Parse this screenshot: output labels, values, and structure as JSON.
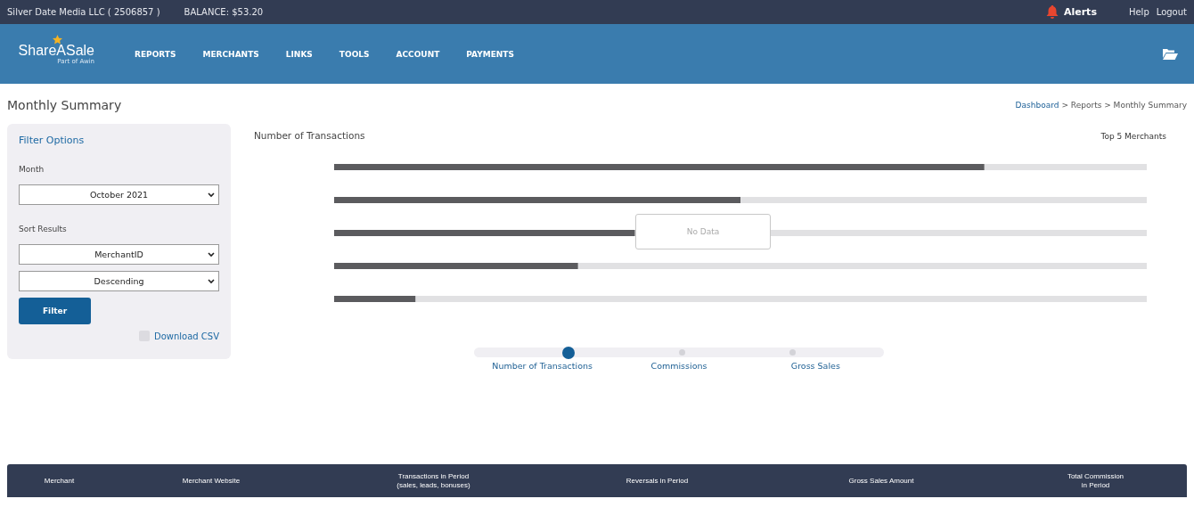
{
  "top_bar": {
    "account": "Silver Date Media LLC ( 2506857 )",
    "balance": "BALANCE: $53.20",
    "alerts": "Alerts",
    "links": [
      "Help",
      "Logout"
    ]
  },
  "header": {
    "logo": "ShareASale",
    "logo_sub": "Part of Awin",
    "nav": [
      "REPORTS",
      "MERCHANTS",
      "LINKS",
      "TOOLS",
      "ACCOUNT",
      "PAYMENTS"
    ]
  },
  "page": {
    "title": "Monthly Summary",
    "breadcrumb": [
      {
        "label": "Dashboard",
        "link": true
      },
      {
        "label": "> Reports > Monthly Summary",
        "link": false
      }
    ]
  },
  "filter": {
    "title": "Filter Options",
    "month_label": "Month",
    "month": "October 2021",
    "sort_label": "Sort Results",
    "sort_by": "MerchantID",
    "order": "Descending",
    "button": "Filter",
    "download": {
      "label": "Download CSV",
      "checked": false
    }
  },
  "chart": {
    "title": "Number of Transactions",
    "subtitle": "Top 5 Merchants",
    "no_data": "No Data",
    "views": [
      {
        "label": "Number of Transactions",
        "selected": true
      },
      {
        "label": "Commissions",
        "selected": false
      },
      {
        "label": "Gross Sales",
        "selected": false
      }
    ]
  },
  "table": {
    "columns": [
      {
        "label": "Merchant"
      },
      {
        "label": "Merchant Website"
      },
      {
        "label": "Transactions in Period",
        "sub": "(sales, leads, bonuses)"
      },
      {
        "label": "Reversals in Period"
      },
      {
        "label": "Gross Sales Amount"
      },
      {
        "label": "Total Commission",
        "sub": "in Period"
      }
    ]
  }
}
